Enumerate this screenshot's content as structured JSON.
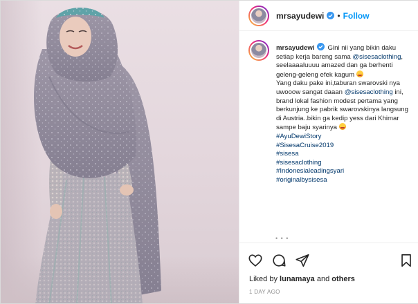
{
  "post": {
    "username": "mrsayudewi",
    "separator": "•",
    "follow_label": "Follow",
    "verified": true
  },
  "caption": {
    "username": "mrsayudewi",
    "line1": "Gini nii yang bikin daku setiap kerja bareng sama",
    "mention1": "@sisesaclothing",
    "line2": ", seelaaaaluuuu amazed dan ga berhenti geleng-geleng efek kagum",
    "line3": "Yang daku pake ini,taburan swarovski nya uwooow sangat daaan",
    "mention2": "@sisesaclothing",
    "line4": "ini, brand lokal fashion modest pertama yang berkunjung ke pabrik swarovskinya langsung di Austria..bikin ga kedip yess dari Khimar sampe baju syarinya",
    "hashtags": [
      "#AyuDewiStory",
      "#SisesaCruise2019",
      "#sisesa",
      "#sisesaclothing",
      "#Indonesialeadingsyari",
      "#originalbysisesa"
    ],
    "more": "• • •"
  },
  "actions": {
    "like_icon": "heart-icon",
    "comment_icon": "comment-icon",
    "share_icon": "share-icon",
    "save_icon": "bookmark-icon"
  },
  "likes": {
    "prefix": "Liked by",
    "user": "lunamaya",
    "joiner": "and",
    "others": "others"
  },
  "timestamp": "1 DAY AGO",
  "colors": {
    "link": "#00376b",
    "follow": "#0095f6",
    "muted": "#8e8e8e",
    "gown": "#8f8a9a"
  }
}
